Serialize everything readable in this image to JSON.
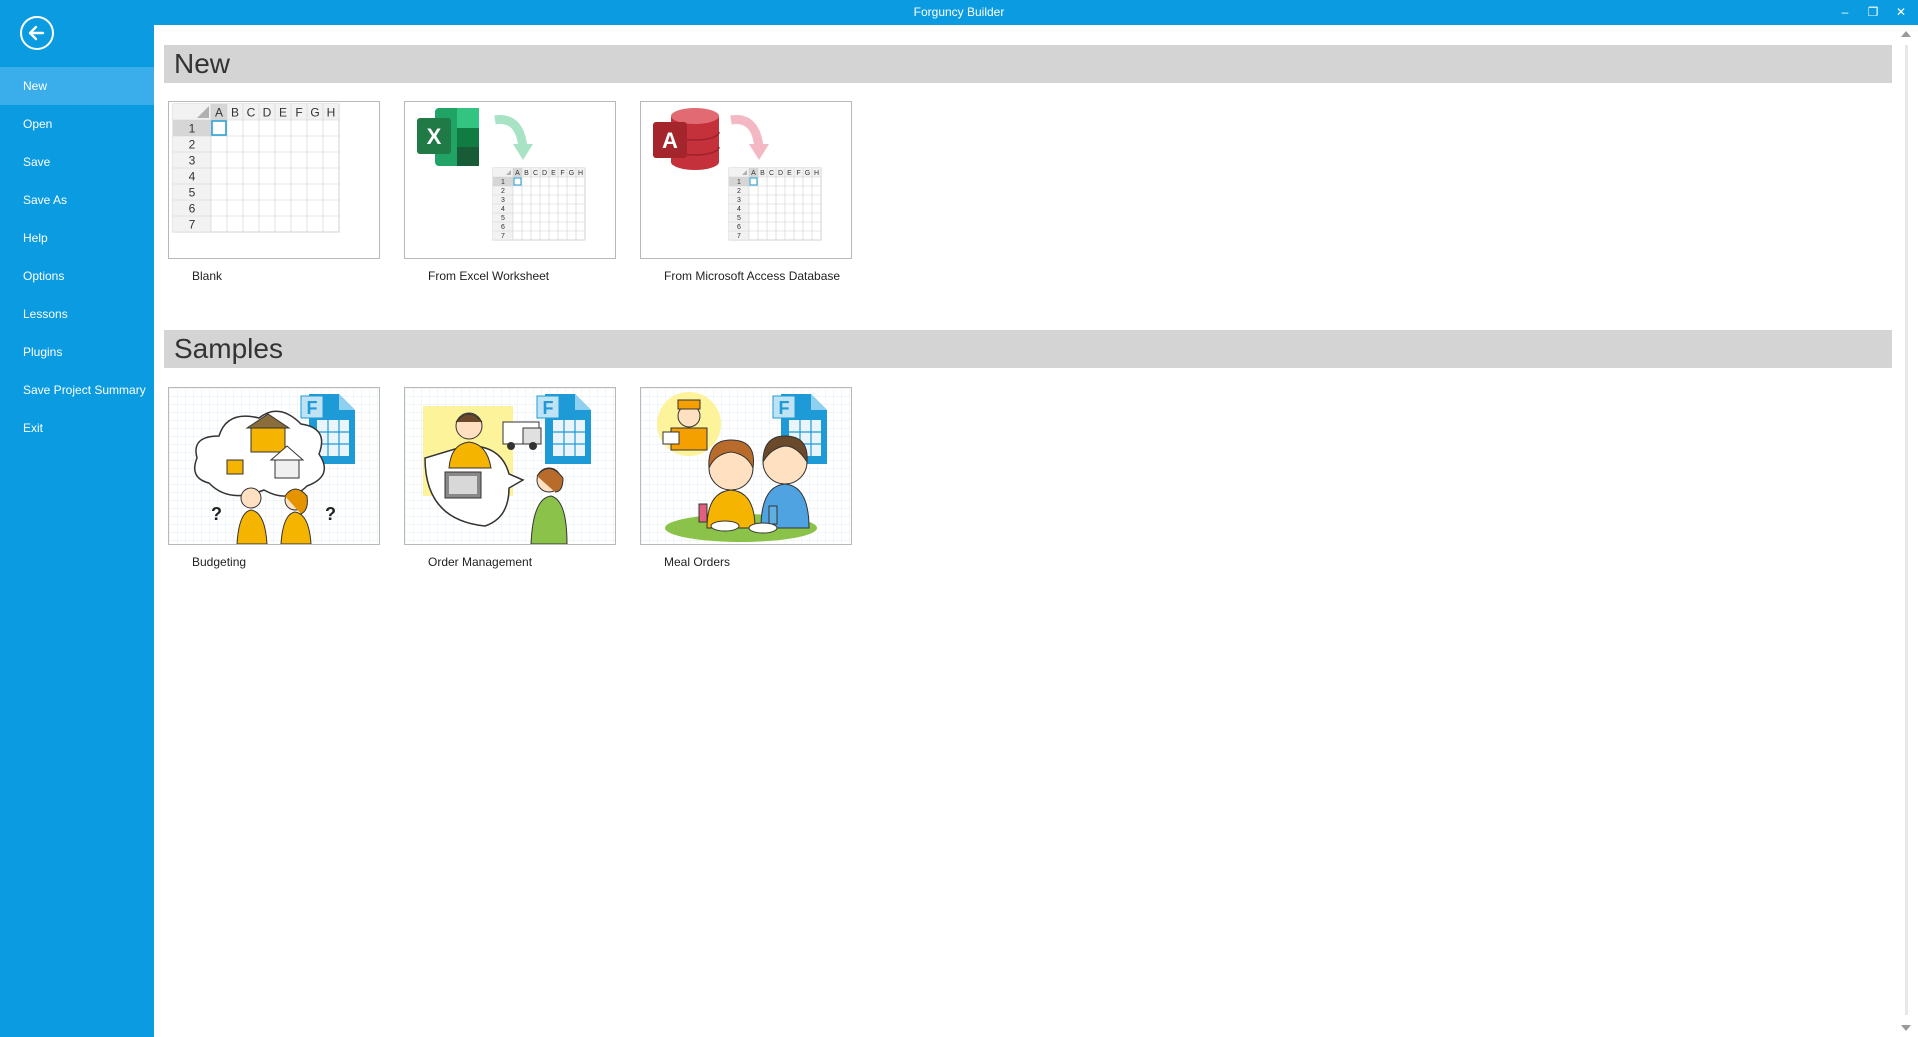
{
  "window": {
    "title": "Forguncy Builder",
    "minimize_glyph": "–",
    "restore_glyph": "❐",
    "close_glyph": "✕"
  },
  "sidebar": {
    "back_icon": "arrow-left-circle-icon",
    "items": [
      {
        "label": "New",
        "active": true
      },
      {
        "label": "Open"
      },
      {
        "label": "Save"
      },
      {
        "label": "Save As"
      },
      {
        "label": "Help"
      },
      {
        "label": "Options"
      },
      {
        "label": "Lessons"
      },
      {
        "label": "Plugins"
      },
      {
        "label": "Save Project Summary"
      },
      {
        "label": "Exit"
      }
    ]
  },
  "sections": {
    "new": {
      "title": "New",
      "cards": [
        {
          "label": "Blank",
          "icon": "blank-spreadsheet-icon"
        },
        {
          "label": "From Excel Worksheet",
          "icon": "excel-import-icon"
        },
        {
          "label": "From Microsoft Access Database",
          "icon": "access-import-icon"
        }
      ]
    },
    "samples": {
      "title": "Samples",
      "cards": [
        {
          "label": "Budgeting",
          "icon": "budgeting-illustration-icon"
        },
        {
          "label": "Order Management",
          "icon": "order-management-illustration-icon"
        },
        {
          "label": "Meal Orders",
          "icon": "meal-orders-illustration-icon"
        }
      ]
    }
  },
  "grid": {
    "columns": [
      "A",
      "B",
      "C",
      "D",
      "E",
      "F",
      "G",
      "H"
    ],
    "rows": [
      "1",
      "2",
      "3",
      "4",
      "5",
      "6",
      "7"
    ]
  },
  "colors": {
    "accent": "#0b9be0",
    "active_item": "#3aaeea",
    "section_header": "#d4d4d4",
    "excel_green": "#1f7a45",
    "access_red": "#b3202b"
  }
}
